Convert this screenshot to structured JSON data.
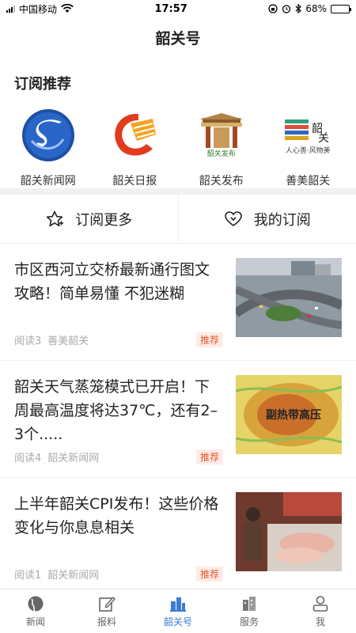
{
  "status": {
    "carrier": "中国移动",
    "time": "17:57",
    "battery": "68%",
    "battery_level": 0.68
  },
  "nav": {
    "title": "韶关号"
  },
  "recommend": {
    "title": "订阅推荐",
    "items": [
      {
        "label": "韶关新闻网",
        "icon": "shaoguan-news-logo-icon"
      },
      {
        "label": "韶关日报",
        "icon": "shaoguan-daily-logo-icon"
      },
      {
        "label": "韶关发布",
        "icon": "shaoguan-release-logo-icon",
        "logo_text": "韶关发布"
      },
      {
        "label": "善美韶关",
        "icon": "shanmei-logo-icon",
        "logo_text": "人心善·风物美"
      }
    ]
  },
  "actions": {
    "more": "订阅更多",
    "mine": "我的订阅"
  },
  "news": [
    {
      "title": "市区西河立交桥最新通行图文攻略！简单易懂 不犯迷糊",
      "reads": "阅读3",
      "source": "善美韶关",
      "tag": "推荐"
    },
    {
      "title": "韶关天气蒸笼模式已开启！下周最高温度将达37℃，还有2–3个.....",
      "reads": "阅读4",
      "source": "韶关新闻网",
      "tag": "推荐",
      "thumb_text": "副热带高压"
    },
    {
      "title": "上半年韶关CPI发布！这些价格变化与你息息相关",
      "reads": "阅读1",
      "source": "韶关新闻网",
      "tag": "推荐"
    }
  ],
  "tabs": [
    {
      "label": "新闻",
      "icon": "globe-icon"
    },
    {
      "label": "报料",
      "icon": "edit-icon"
    },
    {
      "label": "韶关号",
      "icon": "buildings-icon",
      "active": true
    },
    {
      "label": "服务",
      "icon": "city-icon"
    },
    {
      "label": "我",
      "icon": "user-icon"
    }
  ],
  "colors": {
    "accent": "#3a7bd5",
    "tag": "#e5582e"
  }
}
